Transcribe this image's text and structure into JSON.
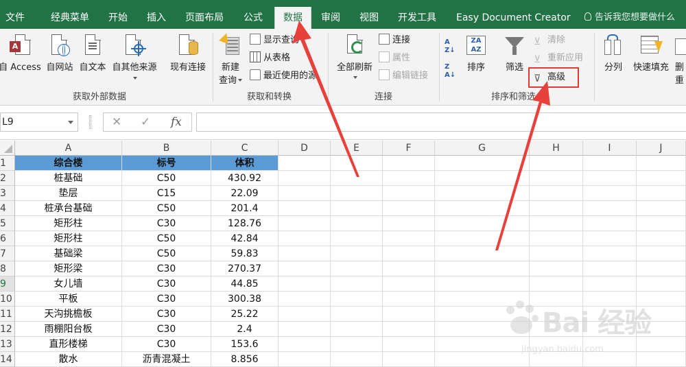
{
  "tabs": [
    {
      "label": "文件"
    },
    {
      "label": "经典菜单"
    },
    {
      "label": "开始"
    },
    {
      "label": "插入"
    },
    {
      "label": "页面布局"
    },
    {
      "label": "公式"
    },
    {
      "label": "数据",
      "active": true
    },
    {
      "label": "审阅"
    },
    {
      "label": "视图"
    },
    {
      "label": "开发工具"
    },
    {
      "label": "Easy Document Creator"
    }
  ],
  "tell_me": "告诉我您想要做什么",
  "ribbon": {
    "get_external": {
      "label": "获取外部数据",
      "access": "自 Access",
      "web": "自网站",
      "text": "自文本",
      "other": "自其他来源",
      "existing": "现有连接"
    },
    "get_transform": {
      "label": "获取和转换",
      "new_query": "新建",
      "new_query_2": "查询",
      "show_queries": "显示查询",
      "from_table": "从表格",
      "recent_sources": "最近使用的源"
    },
    "connections": {
      "label": "连接",
      "refresh_all": "全部刷新",
      "connections": "连接",
      "properties": "属性",
      "edit_links": "编辑链接"
    },
    "sort_filter": {
      "label": "排序和筛选",
      "sort": "排序",
      "filter": "筛选",
      "clear": "清除",
      "reapply": "重新应用",
      "advanced": "高级"
    },
    "data_tools": {
      "text_to_columns": "分列",
      "flash_fill": "快速填充",
      "remove_dup": "删",
      "remove_dup_2": "重"
    }
  },
  "formula_bar": {
    "name_box": "L9",
    "cancel": "✕",
    "enter": "✓",
    "fx": "fx",
    "value": ""
  },
  "columns": [
    "A",
    "B",
    "C",
    "D",
    "E",
    "F",
    "G",
    "H",
    "I",
    "J"
  ],
  "rows": [
    {
      "n": "1",
      "a": "综合楼",
      "b": "标号",
      "c": "体积",
      "header": true
    },
    {
      "n": "2",
      "a": "桩基础",
      "b": "C50",
      "c": "430.92"
    },
    {
      "n": "3",
      "a": "垫层",
      "b": "C15",
      "c": "22.09"
    },
    {
      "n": "4",
      "a": "桩承台基础",
      "b": "C50",
      "c": "201.4"
    },
    {
      "n": "5",
      "a": "矩形柱",
      "b": "C30",
      "c": "128.76"
    },
    {
      "n": "6",
      "a": "矩形柱",
      "b": "C50",
      "c": "42.84"
    },
    {
      "n": "7",
      "a": "基础梁",
      "b": "C50",
      "c": "59.83"
    },
    {
      "n": "8",
      "a": "矩形梁",
      "b": "C30",
      "c": "270.37"
    },
    {
      "n": "9",
      "a": "女儿墙",
      "b": "C30",
      "c": "44.85",
      "selected": true
    },
    {
      "n": "10",
      "a": "平板",
      "b": "C30",
      "c": "300.38"
    },
    {
      "n": "11",
      "a": "天沟挑檐板",
      "b": "C30",
      "c": "25.22"
    },
    {
      "n": "12",
      "a": "雨棚阳台板",
      "b": "C30",
      "c": "2.4"
    },
    {
      "n": "13",
      "a": "直形楼梯",
      "b": "C30",
      "c": "153.6"
    },
    {
      "n": "14",
      "a": "散水",
      "b": "沥青混凝土",
      "c": "8.856"
    }
  ],
  "watermark": {
    "brand": "Bai 经验",
    "url": "jingyan.baidu.com"
  },
  "colors": {
    "excel_green": "#217346",
    "header_fill": "#5b9bd5",
    "annotation_red": "#e03a35"
  }
}
